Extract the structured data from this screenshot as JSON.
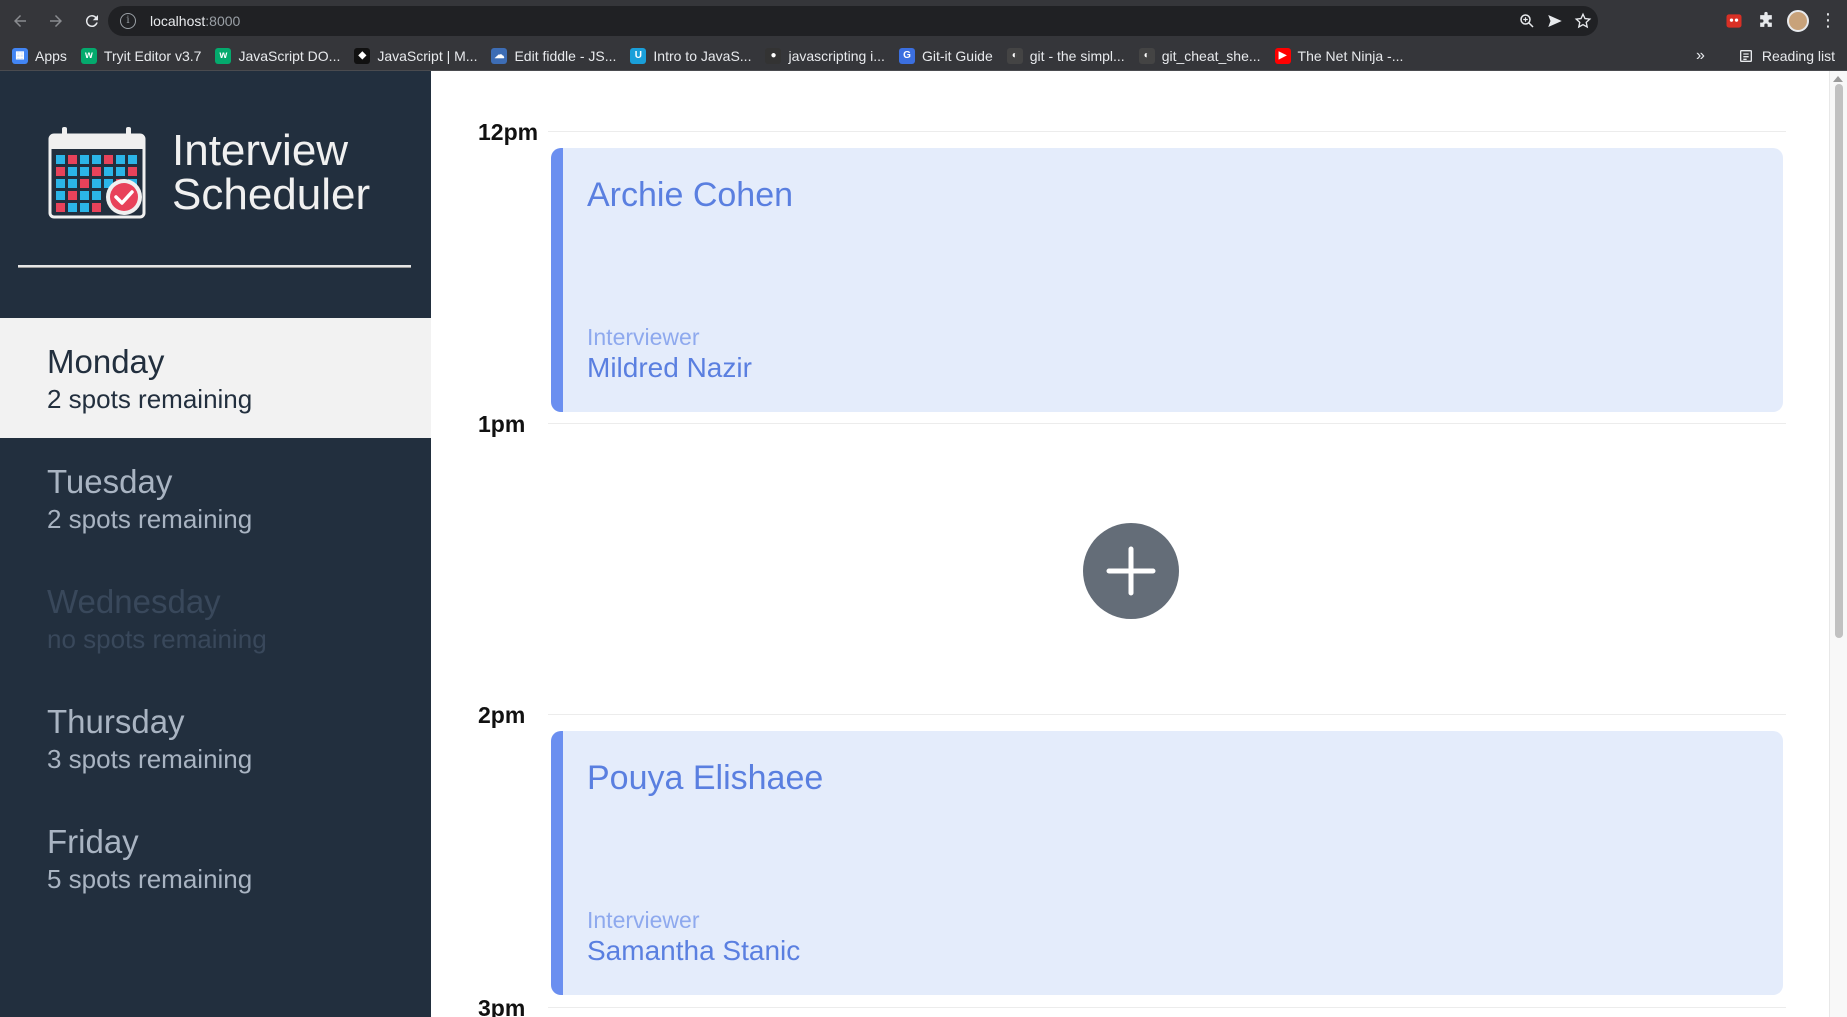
{
  "browser": {
    "url_host": "localhost",
    "url_port": ":8000",
    "bookmarks": [
      {
        "label": "Apps",
        "color": "#4285f4",
        "glyph": "▦"
      },
      {
        "label": "Tryit Editor v3.7",
        "color": "#04aa6d",
        "glyph": "w"
      },
      {
        "label": "JavaScript DO...",
        "color": "#04aa6d",
        "glyph": "w"
      },
      {
        "label": "JavaScript | M...",
        "color": "#111111",
        "glyph": "◆"
      },
      {
        "label": "Edit fiddle - JS...",
        "color": "#3d6db5",
        "glyph": "☁"
      },
      {
        "label": "Intro to JavaS...",
        "color": "#1a9fd9",
        "glyph": "U"
      },
      {
        "label": "javascripting i...",
        "color": "#333333",
        "glyph": "●"
      },
      {
        "label": "Git-it Guide",
        "color": "#3b6fe0",
        "glyph": "G"
      },
      {
        "label": "git - the simpl...",
        "color": "#444444",
        "glyph": "◐"
      },
      {
        "label": "git_cheat_she...",
        "color": "#444444",
        "glyph": "◐"
      },
      {
        "label": "The Net Ninja -...",
        "color": "#ff0000",
        "glyph": "▶"
      }
    ],
    "more_label": "»",
    "reading_list_label": "Reading list"
  },
  "app": {
    "title_line1": "Interview",
    "title_line2": "Scheduler"
  },
  "days": [
    {
      "name": "Monday",
      "spots": "2 spots remaining",
      "state": "selected"
    },
    {
      "name": "Tuesday",
      "spots": "2 spots remaining",
      "state": "normal"
    },
    {
      "name": "Wednesday",
      "spots": "no spots remaining",
      "state": "full"
    },
    {
      "name": "Thursday",
      "spots": "3 spots remaining",
      "state": "normal"
    },
    {
      "name": "Friday",
      "spots": "5 spots remaining",
      "state": "normal"
    }
  ],
  "schedule": {
    "times": [
      "12pm",
      "1pm",
      "2pm",
      "3pm"
    ],
    "appointments": [
      {
        "student": "Archie Cohen",
        "interviewer_label": "Interviewer",
        "interviewer": "Mildred Nazir"
      },
      {
        "student": "Pouya Elishaee",
        "interviewer_label": "Interviewer",
        "interviewer": "Samantha Stanic"
      }
    ]
  },
  "colors": {
    "sidebar_bg": "#222f3e",
    "appointment_bg": "#e4ecfb",
    "appointment_accent": "#6b8ff0",
    "add_button": "#646d78"
  }
}
